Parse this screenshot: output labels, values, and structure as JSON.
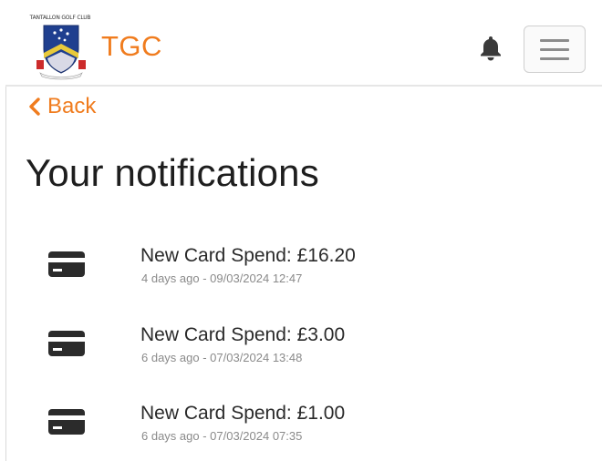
{
  "header": {
    "logo_caption": "TANTALLON GOLF CLUB",
    "brand_name": "TGC",
    "notifications_icon": "bell-icon",
    "menu_icon": "hamburger-menu-icon"
  },
  "nav": {
    "back_label": "Back",
    "back_icon": "chevron-left-icon"
  },
  "page": {
    "title": "Your notifications"
  },
  "notifications": [
    {
      "icon": "credit-card-icon",
      "title": "New Card Spend: £16.20",
      "meta": "4 days ago - 09/03/2024 12:47"
    },
    {
      "icon": "credit-card-icon",
      "title": "New Card Spend: £3.00",
      "meta": "6 days ago - 07/03/2024 13:48"
    },
    {
      "icon": "credit-card-icon",
      "title": "New Card Spend: £1.00",
      "meta": "6 days ago - 07/03/2024 07:35"
    }
  ],
  "colors": {
    "accent": "#f07c1e",
    "text_primary": "#1e1e1e",
    "text_secondary": "#8a8a8a",
    "icon_dark": "#2b2b2b",
    "divider": "#e6e6e6"
  }
}
